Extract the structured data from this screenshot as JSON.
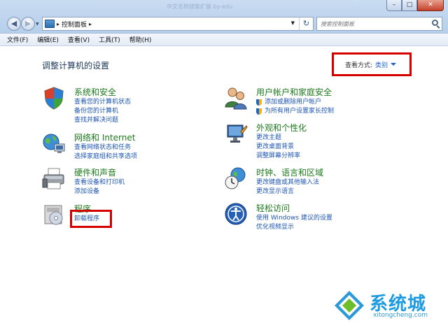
{
  "window": {
    "faded_title": "中文名称搜索扩展 by-edu",
    "controls": {
      "minimize": "–",
      "maximize": "□",
      "close": "✕"
    }
  },
  "nav": {
    "back_glyph": "◀",
    "forward_glyph": "▶",
    "dropdown_glyph": "▼",
    "address": "控制面板",
    "address_sep": "▸",
    "address_end_sep": "▸",
    "refresh_glyph": "↻",
    "search_placeholder": "搜索控制面板"
  },
  "menubar": {
    "items": [
      "文件(F)",
      "编辑(E)",
      "查看(V)",
      "工具(T)",
      "帮助(H)"
    ]
  },
  "main": {
    "title": "调整计算机的设置",
    "view_by": {
      "label": "查看方式:",
      "value": "类别"
    },
    "categories": [
      {
        "title": "系统和安全",
        "icon": "shield-icon",
        "links": [
          "查看您的计算机状态",
          "备份您的计算机",
          "查找并解决问题"
        ]
      },
      {
        "title": "网络和 Internet",
        "icon": "network-globe-icon",
        "links": [
          "查看网络状态和任务",
          "选择家庭组和共享选项"
        ]
      },
      {
        "title": "硬件和声音",
        "icon": "printer-icon",
        "links": [
          "查看设备和打印机",
          "添加设备"
        ]
      },
      {
        "title": "程序",
        "icon": "programs-icon",
        "links": [
          "卸载程序"
        ]
      },
      {
        "title": "用户帐户和家庭安全",
        "icon": "users-icon",
        "links": [
          "添加或删除用户帐户",
          "为所有用户设置家长控制"
        ]
      },
      {
        "title": "外观和个性化",
        "icon": "display-icon",
        "links": [
          "更改主题",
          "更改桌面背景",
          "调整屏幕分辨率"
        ]
      },
      {
        "title": "时钟、语言和区域",
        "icon": "clock-globe-icon",
        "links": [
          "更改键盘或其他输入法",
          "更改显示语言"
        ]
      },
      {
        "title": "轻松访问",
        "icon": "ease-of-access-icon",
        "links": [
          "使用 Windows 建议的设置",
          "优化视频显示"
        ]
      }
    ]
  },
  "watermark": {
    "brand": "系统城",
    "domain": "xitongcheng.com"
  },
  "colors": {
    "category_title": "#1c7a1c",
    "link": "#1e56b3",
    "highlight": "#d40000"
  }
}
